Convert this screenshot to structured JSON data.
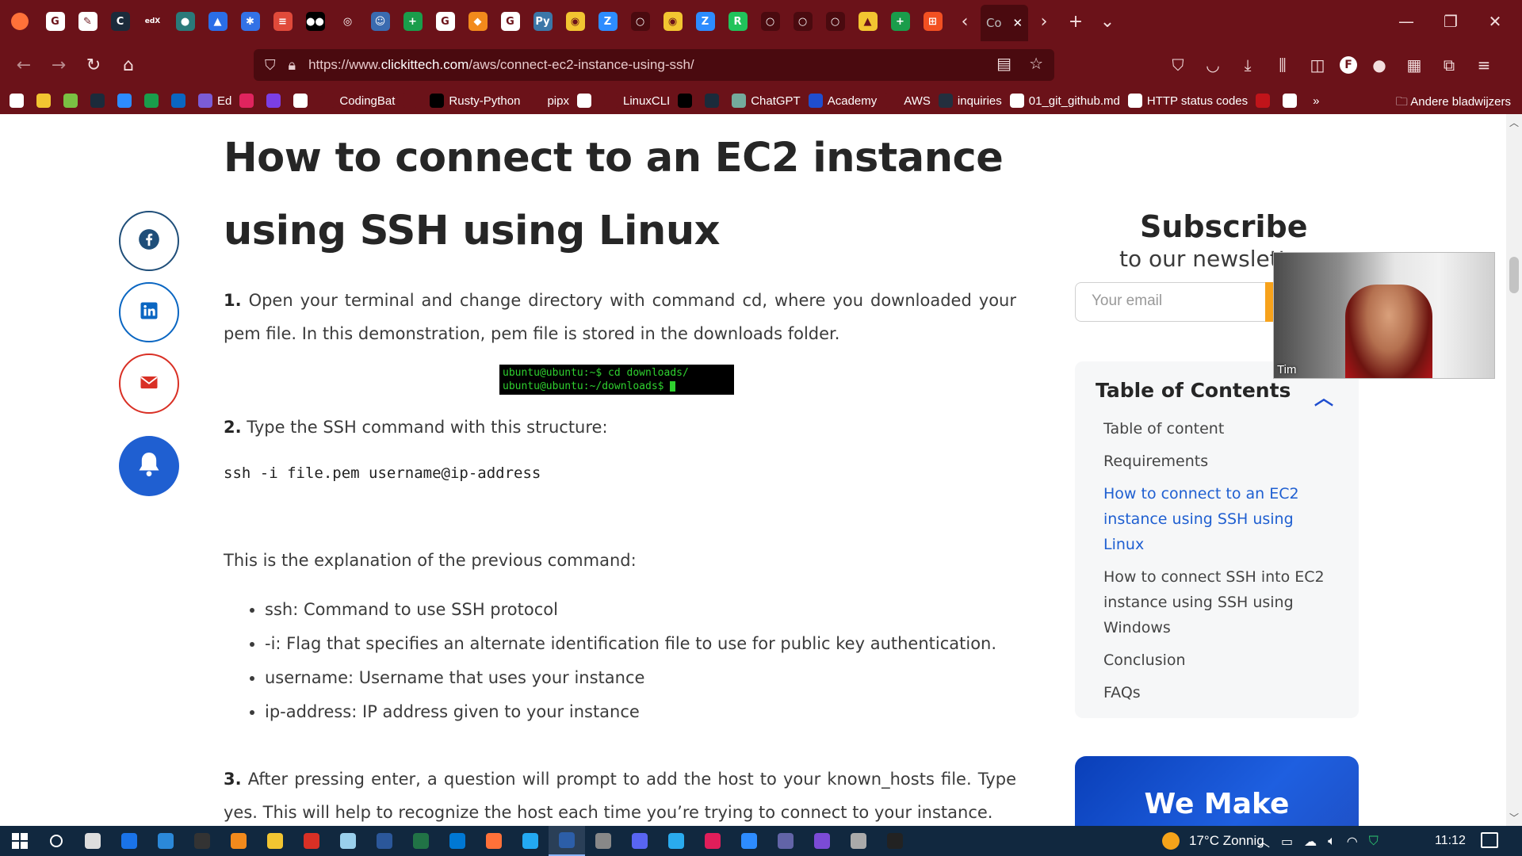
{
  "browser": {
    "url_prefix": "https://www.",
    "url_domain": "clickittech.com",
    "url_path": "/aws/connect-ec2-instance-using-ssh/",
    "active_tab_label": "Co",
    "tabs": [
      {
        "icon": "google-icon",
        "color": "#ffffff",
        "glyph": "G"
      },
      {
        "icon": "notes-icon",
        "color": "#ffffff",
        "glyph": "✎"
      },
      {
        "icon": "circle-c-icon",
        "color": "#1b2b3b",
        "glyph": "C"
      },
      {
        "icon": "edx-icon",
        "color": "#6b1219",
        "glyph": "edX"
      },
      {
        "icon": "eye-icon",
        "color": "#2a7a7a",
        "glyph": "●"
      },
      {
        "icon": "triangle-icon",
        "color": "#2a6ee8",
        "glyph": "▲"
      },
      {
        "icon": "kubernetes-icon",
        "color": "#3372e6",
        "glyph": "✱"
      },
      {
        "icon": "stack-icon",
        "color": "#e04a3a",
        "glyph": "≡"
      },
      {
        "icon": "medium-icon",
        "color": "#000000",
        "glyph": "●●"
      },
      {
        "icon": "globe-icon",
        "color": "#6b1219",
        "glyph": "◎"
      },
      {
        "icon": "robot-icon",
        "color": "#3a6bb0",
        "glyph": "☺"
      },
      {
        "icon": "plus-green-icon",
        "color": "#1a9d4b",
        "glyph": "+"
      },
      {
        "icon": "google-icon",
        "color": "#ffffff",
        "glyph": "G"
      },
      {
        "icon": "cube-icon",
        "color": "#f28a1c",
        "glyph": "◆"
      },
      {
        "icon": "google-icon",
        "color": "#ffffff",
        "glyph": "G"
      },
      {
        "icon": "python-icon",
        "color": "#3b77a8",
        "glyph": "Py"
      },
      {
        "icon": "chrome-icon",
        "color": "#f2c531",
        "glyph": "◉"
      },
      {
        "icon": "zoom-icon",
        "color": "#2d8cff",
        "glyph": "Z"
      },
      {
        "icon": "github-icon",
        "color": "#4a0a0f",
        "glyph": "○"
      },
      {
        "icon": "chrome-icon",
        "color": "#f2c531",
        "glyph": "◉"
      },
      {
        "icon": "zoom-icon",
        "color": "#2d8cff",
        "glyph": "Z"
      },
      {
        "icon": "r-icon",
        "color": "#21c35b",
        "glyph": "R"
      },
      {
        "icon": "github-icon",
        "color": "#4a0a0f",
        "glyph": "○"
      },
      {
        "icon": "github-icon",
        "color": "#4a0a0f",
        "glyph": "○"
      },
      {
        "icon": "github-icon",
        "color": "#4a0a0f",
        "glyph": "○"
      },
      {
        "icon": "drive-icon",
        "color": "#f2c531",
        "glyph": "▲"
      },
      {
        "icon": "plus-green-icon",
        "color": "#1a9d4b",
        "glyph": "+"
      },
      {
        "icon": "windows-color-icon",
        "color": "#f25022",
        "glyph": "⊞"
      }
    ],
    "bookmarks": [
      {
        "label": "",
        "color": "#ffffff"
      },
      {
        "label": "",
        "color": "#f2c531"
      },
      {
        "label": "",
        "color": "#7ac143"
      },
      {
        "label": "",
        "color": "#1b2b3b"
      },
      {
        "label": "",
        "color": "#2d8cff"
      },
      {
        "label": "",
        "color": "#1a9d4b"
      },
      {
        "label": "",
        "color": "#0a66c2"
      },
      {
        "label": "Ed",
        "color": "#7b5cd6"
      },
      {
        "label": "",
        "color": "#e0245e"
      },
      {
        "label": "",
        "color": "#7b3fe4"
      },
      {
        "label": "",
        "color": "#ffffff"
      },
      {
        "label": "CodingBat",
        "color": "#6b1219"
      },
      {
        "label": "",
        "color": "#6b1219"
      },
      {
        "label": "Rusty-Python",
        "color": "#000000"
      },
      {
        "label": "pipx",
        "color": "#6b1219"
      },
      {
        "label": "",
        "color": "#ffffff"
      },
      {
        "label": "LinuxCLI",
        "color": "#6b1219"
      },
      {
        "label": "",
        "color": "#000000"
      },
      {
        "label": "",
        "color": "#1b2b3b"
      },
      {
        "label": "ChatGPT",
        "color": "#74aa9c"
      },
      {
        "label": "Academy",
        "color": "#1f4ecf"
      },
      {
        "label": "AWS",
        "color": "#6b1219"
      },
      {
        "label": "inquiries",
        "color": "#232f3e"
      },
      {
        "label": "01_git_github.md",
        "color": "#ffffff"
      },
      {
        "label": "HTTP status codes",
        "color": "#ffffff"
      },
      {
        "label": "",
        "color": "#c0141a"
      },
      {
        "label": "",
        "color": "#ffffff"
      }
    ],
    "bookmarks_folder": "Andere bladwijzers"
  },
  "share": [
    {
      "name": "facebook-share-button",
      "icon": "facebook-icon",
      "color": "#1f4e79"
    },
    {
      "name": "linkedin-share-button",
      "icon": "linkedin-icon",
      "color": "#0a66c2"
    },
    {
      "name": "email-share-button",
      "icon": "mail-icon",
      "color": "#d93025"
    },
    {
      "name": "notification-bell-button",
      "icon": "bell-icon",
      "color": "#1f5fd1"
    }
  ],
  "article": {
    "title": "How to connect to an EC2 instance using SSH using Linux",
    "step1_num": "1.",
    "step1_text": " Open your terminal and change directory with command cd, where you downloaded your pem file. In this demonstration, pem file is stored in the downloads folder.",
    "terminal_line1": "ubuntu@ubuntu:~$ cd downloads/",
    "terminal_line2": "ubuntu@ubuntu:~/downloads$ ",
    "step2_num": "2.",
    "step2_text": " Type the SSH command with this structure:",
    "code": "ssh -i file.pem username@ip-address",
    "explain": "This is the explanation of the previous command:",
    "bullets": [
      "ssh: Command to use SSH protocol",
      "-i: Flag that specifies an alternate identification file to use for public key authentication.",
      "username: Username that uses your instance",
      "ip-address: IP address given to your instance"
    ],
    "step3_num": "3.",
    "step3_text": " After pressing enter, a question will prompt to add the host to your known_hosts file. Type yes. This will help to recognize the host each time you’re trying to connect to your instance."
  },
  "sidebar": {
    "subscribe_title": "Subscribe",
    "subscribe_sub": "to our newsletter",
    "email_placeholder": "Your email",
    "submit_glyph": "→",
    "toc_title": "Table of Contents",
    "toc_items": [
      {
        "label": "Table of content",
        "active": false
      },
      {
        "label": "Requirements",
        "active": false
      },
      {
        "label": "How to connect to an EC2 instance using SSH using Linux",
        "active": true
      },
      {
        "label": "How to connect SSH into EC2 instance using SSH using Windows",
        "active": false
      },
      {
        "label": "Conclusion",
        "active": false
      },
      {
        "label": "FAQs",
        "active": false
      }
    ],
    "banner_text": "We Make"
  },
  "webcam": {
    "name": "Tim"
  },
  "taskbar": {
    "apps": [
      {
        "icon": "search-icon",
        "color": "#ffffff"
      },
      {
        "icon": "shield-app-icon",
        "color": "#dddddd"
      },
      {
        "icon": "app-blue-icon",
        "color": "#1a73e8"
      },
      {
        "icon": "app-mail-icon",
        "color": "#2b88d8"
      },
      {
        "icon": "app-dark-icon",
        "color": "#333333"
      },
      {
        "icon": "app-orange-icon",
        "color": "#f28a1c"
      },
      {
        "icon": "folder-icon",
        "color": "#f2c531"
      },
      {
        "icon": "acrobat-icon",
        "color": "#d93025"
      },
      {
        "icon": "app-notes-icon",
        "color": "#9ad0ec"
      },
      {
        "icon": "word-icon",
        "color": "#2b579a"
      },
      {
        "icon": "excel-icon",
        "color": "#217346"
      },
      {
        "icon": "outlook-icon",
        "color": "#0078d4"
      },
      {
        "icon": "firefox-icon",
        "color": "#ff7139"
      },
      {
        "icon": "vscode-icon",
        "color": "#23a9f2"
      },
      {
        "icon": "powershell-icon",
        "color": "#2c5ea8",
        "active": true
      },
      {
        "icon": "app-window-icon",
        "color": "#888888"
      },
      {
        "icon": "discord-icon",
        "color": "#5865f2"
      },
      {
        "icon": "telegram-icon",
        "color": "#2aabee"
      },
      {
        "icon": "slack-icon",
        "color": "#e01e5a"
      },
      {
        "icon": "zoom-icon",
        "color": "#2d8cff"
      },
      {
        "icon": "teams-icon",
        "color": "#6264a7"
      },
      {
        "icon": "github-icon",
        "color": "#7b4bd6"
      },
      {
        "icon": "app-grey-icon",
        "color": "#aaaaaa"
      },
      {
        "icon": "terminal-icon",
        "color": "#222222"
      }
    ],
    "weather": "17°C Zonnig",
    "clock": "11:12"
  }
}
